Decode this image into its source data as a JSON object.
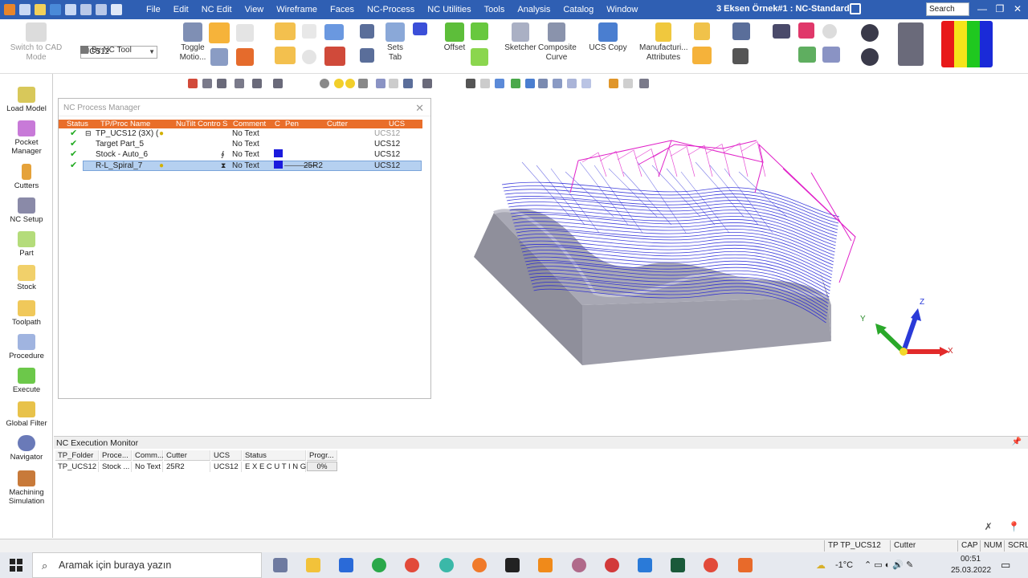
{
  "titlebar": {
    "menu": [
      "File",
      "Edit",
      "NC Edit",
      "View",
      "Wireframe",
      "Faces",
      "NC-Process",
      "NC Utilities",
      "Tools",
      "Analysis",
      "Catalog",
      "Window"
    ],
    "doc_title": "3 Eksen Örnek#1 : NC-Standard",
    "search_placeholder": "Search"
  },
  "ribbon": {
    "switch_cad": "Switch to CAD Mode",
    "ucs_value": "UCS12",
    "by_nc_tool": "By NC Tool",
    "toggle_motion": "Toggle Motio...",
    "sets_tab": "Sets Tab",
    "offset": "Offset",
    "sketcher": "Sketcher",
    "composite_curve": "Composite Curve",
    "ucs_copy": "UCS Copy",
    "manufacturing_attr": "Manufacturi... Attributes"
  },
  "sidebar": {
    "items": [
      "Load Model",
      "Pocket Manager",
      "Cutters",
      "NC Setup",
      "Part",
      "Stock",
      "Toolpath",
      "Procedure",
      "Execute",
      "Global Filter",
      "Navigator",
      "Machining Simulation"
    ]
  },
  "process_manager": {
    "title": "NC Process Manager",
    "columns": [
      "Status",
      "TP/Proc Name",
      "NuTilt Contro",
      "S",
      "Comment",
      "C",
      "Pen",
      "Cutter",
      "UCS"
    ],
    "rows": [
      {
        "name": "TP_UCS12 (3X) (",
        "comment": "No Text",
        "cutter": "",
        "ucs": "UCS12"
      },
      {
        "name": "Target Part_5",
        "comment": "No Text",
        "cutter": "",
        "ucs": "UCS12"
      },
      {
        "name": "Stock - Auto_6",
        "comment": "No Text",
        "cutter": "",
        "ucs": "UCS12"
      },
      {
        "name": "R-L_Spiral_7",
        "comment": "No Text",
        "cutter": "25R2",
        "ucs": "UCS12"
      }
    ]
  },
  "viewport": {
    "axis_x": "X",
    "axis_y": "Y",
    "axis_z": "Z"
  },
  "exec_monitor": {
    "title": "NC Execution Monitor",
    "headers": [
      "TP_Folder",
      "Proce...",
      "Comm...",
      "Cutter",
      "UCS",
      "Status",
      "Progr..."
    ],
    "row": {
      "tp_folder": "TP_UCS12",
      "procedure": "Stock ...",
      "comment": "No Text",
      "cutter": "25R2",
      "ucs": "UCS12",
      "status": "E X E C U T I N G . . .",
      "progress": "0%"
    }
  },
  "statusbar": {
    "tp": "TP  TP_UCS12",
    "cutter": "Cutter",
    "cap": "CAP",
    "num": "NUM",
    "scrl": "SCRL"
  },
  "taskbar": {
    "search_placeholder": "Aramak için buraya yazın",
    "temperature": "-1°C",
    "time": "00:51",
    "date": "25.03.2022"
  },
  "colors": {
    "titlebar": "#2f5fb3",
    "column_header": "#e96e2a",
    "toolpath_blue": "#1f1fd6",
    "toolpath_magenta": "#e020c8",
    "stock_gray": "#9a9aa6"
  }
}
